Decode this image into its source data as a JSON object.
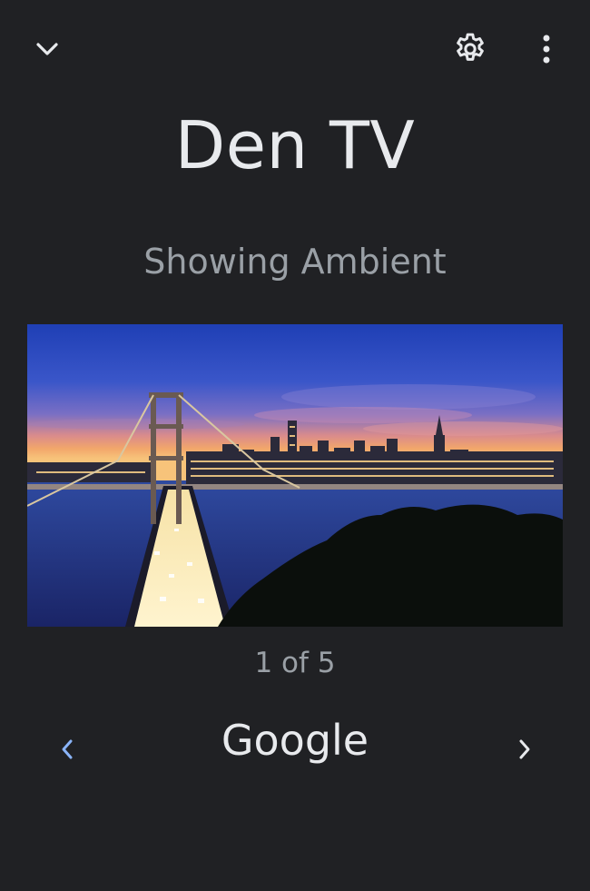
{
  "header": {
    "collapse_icon": "chevron-down-icon",
    "settings_icon": "gear-icon",
    "more_icon": "more-vert-icon"
  },
  "device": {
    "name": "Den TV",
    "status": "Showing Ambient"
  },
  "preview": {
    "description_icon": "ambient-photo",
    "page_indicator": "1 of 5"
  },
  "source": {
    "label": "Google",
    "prev_icon": "chevron-left-icon",
    "next_icon": "chevron-right-icon"
  },
  "colors": {
    "background": "#202124",
    "title_text": "#e8eaed",
    "secondary_text": "#9aa0a6",
    "prev_arrow": "#8ab4f8",
    "next_arrow": "#e8eaed"
  }
}
